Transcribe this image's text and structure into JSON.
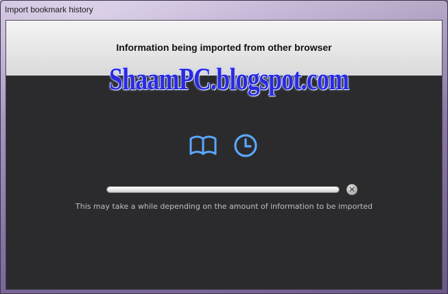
{
  "window": {
    "title": "Import bookmark history"
  },
  "header": {
    "heading": "Information being imported from other browser"
  },
  "watermark": {
    "text": "ShaamPC.blogspot.com"
  },
  "icons": [
    "book-icon",
    "clock-icon"
  ],
  "progress": {
    "fraction": 1.0
  },
  "cancel": {
    "glyph": "✕"
  },
  "status": {
    "note": "This may take a while depending on the amount of information to be imported"
  },
  "colors": {
    "accent_blue": "#5aa8ff",
    "content_bg": "#2b2b2d",
    "header_bg": "#e6e6e6"
  }
}
